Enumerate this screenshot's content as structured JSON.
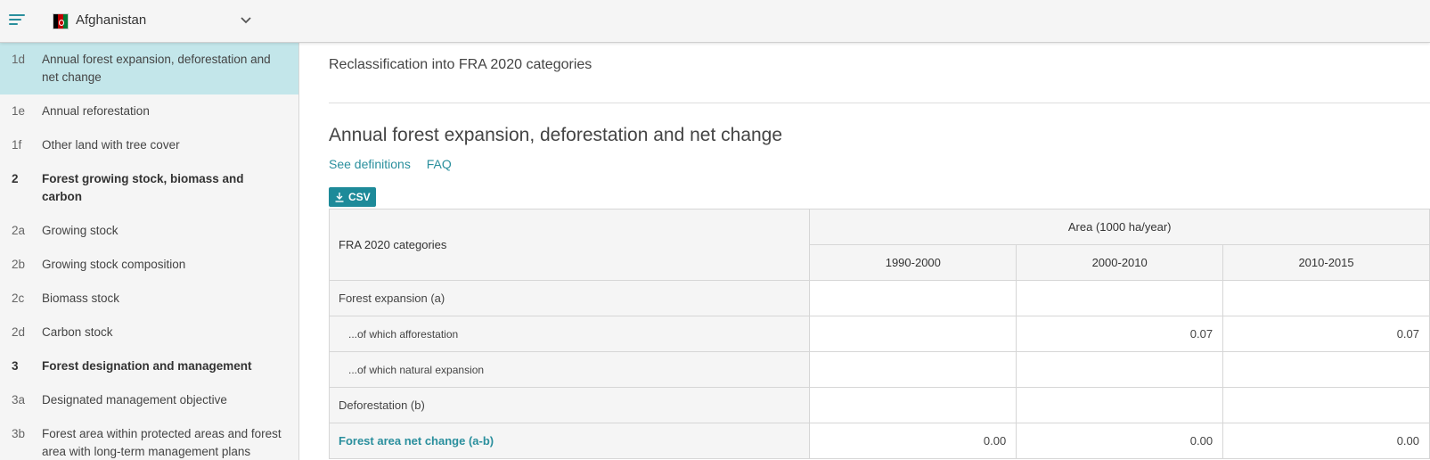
{
  "header": {
    "country": "Afghanistan",
    "menu_icon": "hamburger-menu-icon",
    "dropdown_icon": "chevron-down-icon",
    "flag_colors": [
      "#000000",
      "#be0000",
      "#007a36"
    ]
  },
  "sidebar": {
    "items": [
      {
        "num": "1d",
        "label": "Annual forest expansion, deforestation and net change",
        "active": true,
        "section": false
      },
      {
        "num": "1e",
        "label": "Annual reforestation",
        "active": false,
        "section": false
      },
      {
        "num": "1f",
        "label": "Other land with tree cover",
        "active": false,
        "section": false
      },
      {
        "num": "2",
        "label": "Forest growing stock, biomass and carbon",
        "active": false,
        "section": true
      },
      {
        "num": "2a",
        "label": "Growing stock",
        "active": false,
        "section": false
      },
      {
        "num": "2b",
        "label": "Growing stock composition",
        "active": false,
        "section": false
      },
      {
        "num": "2c",
        "label": "Biomass stock",
        "active": false,
        "section": false
      },
      {
        "num": "2d",
        "label": "Carbon stock",
        "active": false,
        "section": false
      },
      {
        "num": "3",
        "label": "Forest designation and management",
        "active": false,
        "section": true
      },
      {
        "num": "3a",
        "label": "Designated management objective",
        "active": false,
        "section": false
      },
      {
        "num": "3b",
        "label": "Forest area within protected areas and forest area with long-term management plans",
        "active": false,
        "section": false
      }
    ]
  },
  "main": {
    "reclass_title": "Reclassification into FRA 2020 categories",
    "section_title": "Annual forest expansion, deforestation and net change",
    "links": {
      "definitions": "See definitions",
      "faq": "FAQ"
    },
    "csv_label": "CSV",
    "csv_icon": "download-icon",
    "table": {
      "category_header": "FRA 2020 categories",
      "area_header": "Area (1000 ha/year)",
      "years": [
        "1990-2000",
        "2000-2010",
        "2010-2015"
      ],
      "rows": [
        {
          "label": "Forest expansion (a)",
          "values": [
            "",
            "",
            ""
          ]
        },
        {
          "label": "...of which afforestation",
          "values": [
            "",
            "0.07",
            "0.07"
          ]
        },
        {
          "label": "...of which natural expansion",
          "values": [
            "",
            "",
            ""
          ]
        },
        {
          "label": "Deforestation (b)",
          "values": [
            "",
            "",
            ""
          ]
        },
        {
          "label": "Forest area net change (a-b)",
          "values": [
            "0.00",
            "0.00",
            "0.00"
          ]
        }
      ]
    }
  },
  "colors": {
    "accent": "#2a8f9d",
    "active_nav": "#c3e6ea",
    "csv_button": "#1d8a99"
  }
}
